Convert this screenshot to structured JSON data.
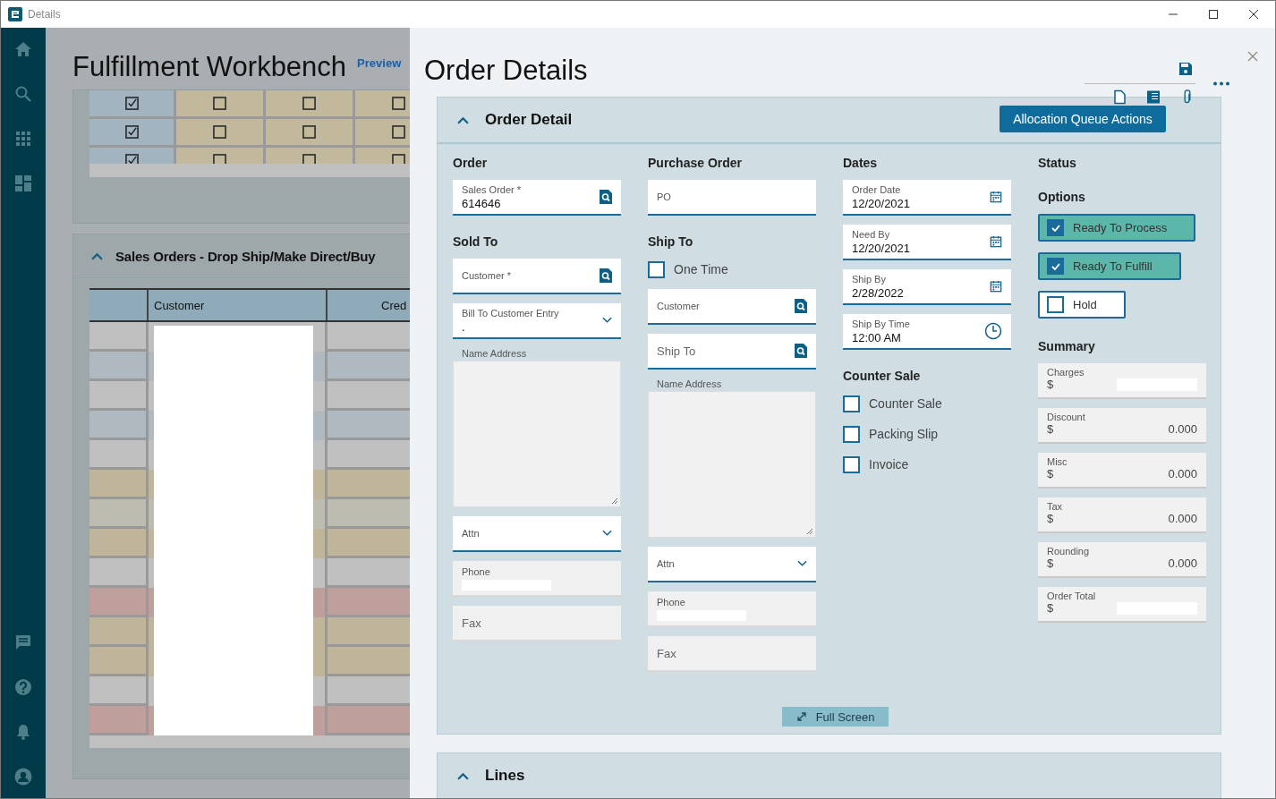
{
  "window": {
    "title": "Details"
  },
  "workbench": {
    "title": "Fulfillment Workbench",
    "preview_link": "Preview",
    "flag_grid": {
      "rows": [
        {
          "checks": [
            true,
            false,
            false,
            false
          ]
        },
        {
          "checks": [
            true,
            false,
            false,
            false
          ]
        },
        {
          "checks": [
            true,
            false,
            false,
            false
          ]
        }
      ]
    },
    "sales_orders": {
      "title": "Sales Orders - Drop Ship/Make Direct/Buy",
      "columns": [
        {
          "label": "Customer"
        },
        {
          "label": "Cred"
        }
      ],
      "customer_column_redacted": true,
      "rows": [
        {
          "color": "#c0c0c0"
        },
        {
          "color": "#b1b9c0"
        },
        {
          "color": "#c0c0c0"
        },
        {
          "color": "#b1b9c0"
        },
        {
          "color": "#c0c0c0"
        },
        {
          "color": "#bfb59b"
        },
        {
          "color": "#bcbdb0"
        },
        {
          "color": "#bfb59b"
        },
        {
          "color": "#c0c0c0"
        },
        {
          "color": "#bf9f9c"
        },
        {
          "color": "#bfb59b"
        },
        {
          "color": "#bfb59b"
        },
        {
          "color": "#c0c0c0"
        },
        {
          "color": "#bf9f9c"
        }
      ]
    }
  },
  "order_details": {
    "title": "Order Details",
    "section": {
      "title": "Order Detail",
      "action_button": "Allocation Queue Actions",
      "columns": [
        {
          "items": [
            {
              "kind": "heading",
              "text": "Order"
            },
            {
              "kind": "search",
              "label": "Sales Order *",
              "value": "614646"
            },
            {
              "kind": "heading",
              "text": "Sold To"
            },
            {
              "kind": "search",
              "label": "Customer *"
            },
            {
              "kind": "dropdown",
              "label": "Bill To Customer Entry",
              "value": "."
            },
            {
              "kind": "textarea",
              "label": "Name Address"
            },
            {
              "kind": "dropdown",
              "label": "Attn"
            },
            {
              "kind": "readonly",
              "label": "Phone",
              "redacted": true
            },
            {
              "kind": "readonly",
              "placeholder": "Fax"
            }
          ]
        },
        {
          "items": [
            {
              "kind": "heading",
              "text": "Purchase Order"
            },
            {
              "kind": "text",
              "label": "PO"
            },
            {
              "kind": "heading",
              "text": "Ship To"
            },
            {
              "kind": "checkbox",
              "label": "One Time",
              "checked": false
            },
            {
              "kind": "search",
              "label": "Customer"
            },
            {
              "kind": "search",
              "placeholder": "Ship To"
            },
            {
              "kind": "textarea",
              "label": "Name Address"
            },
            {
              "kind": "dropdown",
              "label": "Attn"
            },
            {
              "kind": "readonly",
              "label": "Phone",
              "redacted": true
            },
            {
              "kind": "readonly",
              "placeholder": "Fax"
            }
          ]
        },
        {
          "items": [
            {
              "kind": "heading",
              "text": "Dates"
            },
            {
              "kind": "date",
              "label": "Order Date",
              "value": "12/20/2021"
            },
            {
              "kind": "date",
              "label": "Need By",
              "value": "12/20/2021"
            },
            {
              "kind": "date",
              "label": "Ship By",
              "value": "2/28/2022"
            },
            {
              "kind": "time",
              "label": "Ship By Time",
              "value": "12:00 AM"
            },
            {
              "kind": "heading",
              "text": "Counter Sale"
            },
            {
              "kind": "checkbox",
              "label": "Counter Sale",
              "checked": false
            },
            {
              "kind": "checkbox",
              "label": "Packing Slip",
              "checked": false
            },
            {
              "kind": "checkbox",
              "label": "Invoice",
              "checked": false
            }
          ]
        },
        {
          "items": [
            {
              "kind": "heading",
              "text": "Status"
            },
            {
              "kind": "heading",
              "text": "Options"
            },
            {
              "kind": "toggle",
              "label": "Ready To Process",
              "checked": true
            },
            {
              "kind": "toggle",
              "label": "Ready To Fulfill",
              "checked": true
            },
            {
              "kind": "toggle",
              "label": "Hold",
              "checked": false
            },
            {
              "kind": "heading",
              "text": "Summary"
            },
            {
              "kind": "amount",
              "label": "Charges",
              "currency": "$",
              "redacted": true
            },
            {
              "kind": "amount",
              "label": "Discount",
              "currency": "$",
              "value": "0.000"
            },
            {
              "kind": "amount",
              "label": "Misc",
              "currency": "$",
              "value": "0.000"
            },
            {
              "kind": "amount",
              "label": "Tax",
              "currency": "$",
              "value": "0.000"
            },
            {
              "kind": "amount",
              "label": "Rounding",
              "currency": "$",
              "value": "0.000"
            },
            {
              "kind": "amount",
              "label": "Order Total",
              "currency": "$",
              "redacted": true
            }
          ]
        }
      ]
    },
    "full_screen_button": "Full Screen",
    "lines_section": {
      "title": "Lines"
    }
  }
}
